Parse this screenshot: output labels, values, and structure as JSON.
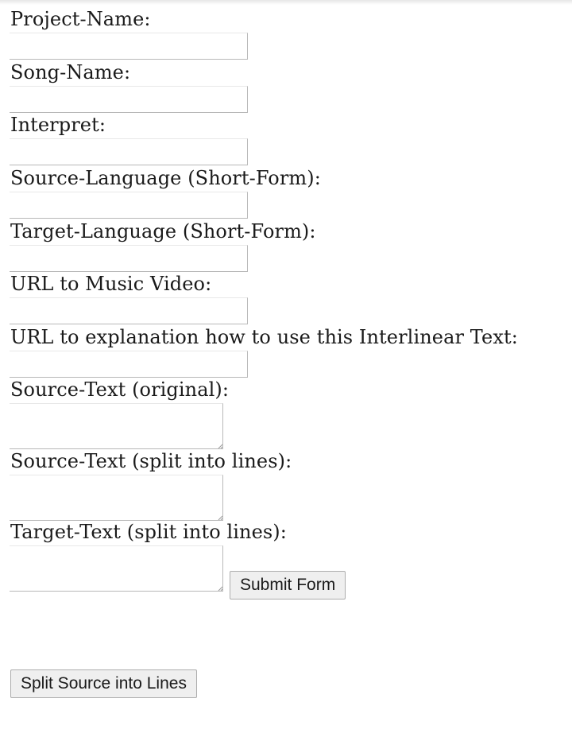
{
  "form": {
    "fields": [
      {
        "label": "Project-Name:",
        "value": ""
      },
      {
        "label": "Song-Name:",
        "value": ""
      },
      {
        "label": "Interpret:",
        "value": ""
      },
      {
        "label": "Source-Language (Short-Form):",
        "value": ""
      },
      {
        "label": "Target-Language (Short-Form):",
        "value": ""
      },
      {
        "label": "URL to Music Video:",
        "value": ""
      },
      {
        "label": "URL to explanation how to use this Interlinear Text:",
        "value": ""
      }
    ],
    "textareas": [
      {
        "label": "Source-Text (original):",
        "value": ""
      },
      {
        "label": "Source-Text (split into lines):",
        "value": ""
      },
      {
        "label": "Target-Text (split into lines):",
        "value": ""
      }
    ],
    "submit_label": "Submit Form",
    "split_label": "Split Source into Lines"
  }
}
